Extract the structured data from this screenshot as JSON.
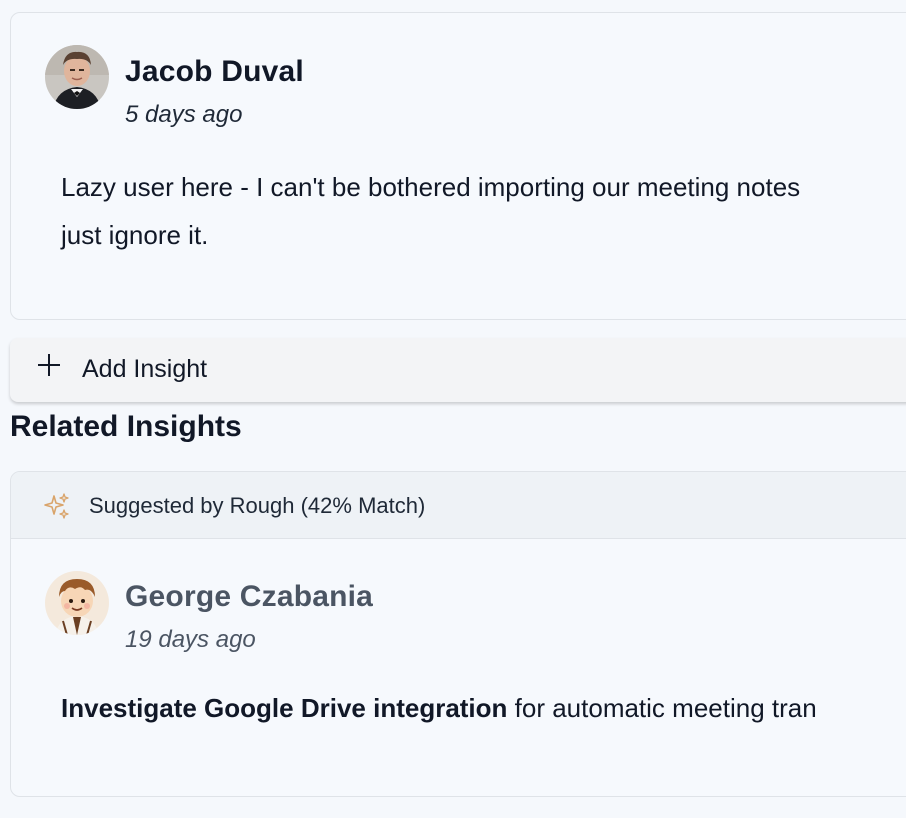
{
  "comment": {
    "author": "Jacob Duval",
    "timestamp": "5 days ago",
    "body_line1": "Lazy user here - I can't be bothered importing our meeting notes",
    "body_line2": "just ignore it."
  },
  "add_insight": {
    "label": "Add Insight",
    "icon": "plus-icon"
  },
  "related": {
    "title": "Related Insights",
    "suggestion_label": "Suggested by Rough (42% Match)",
    "suggestion_icon": "sparkle-icon",
    "accent_color": "#d9a46a",
    "insight": {
      "author": "George Czabania",
      "timestamp": "19 days ago",
      "body_bold": "Investigate Google Drive integration",
      "body_rest": " for automatic meeting tran"
    }
  }
}
